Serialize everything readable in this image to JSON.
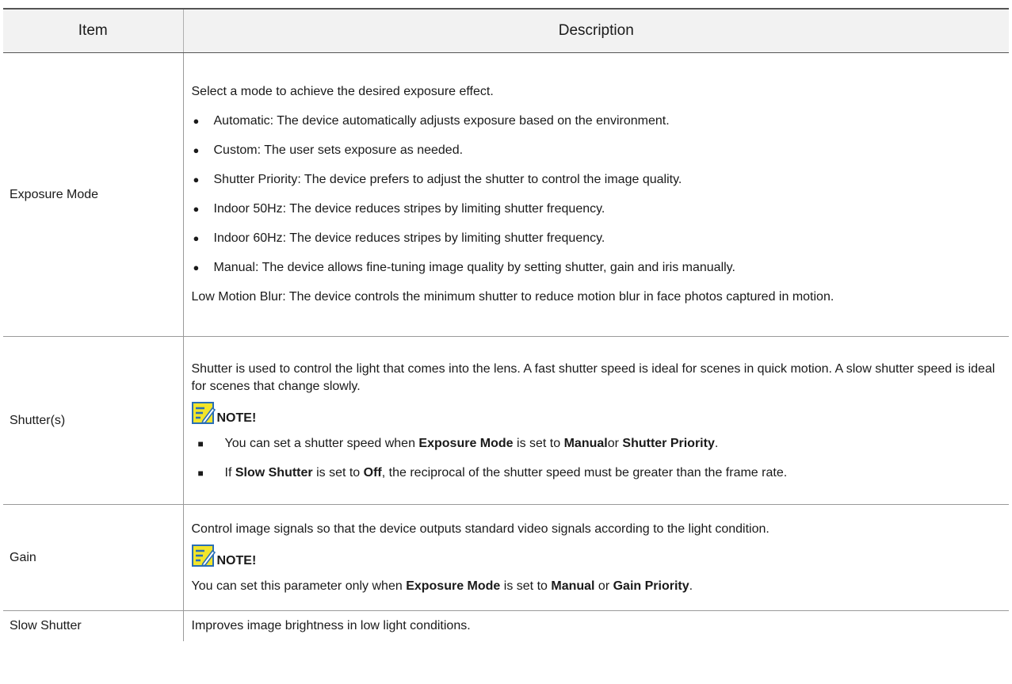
{
  "table": {
    "headers": {
      "item": "Item",
      "description": "Description"
    },
    "rows": {
      "exposure": {
        "item": "Exposure Mode",
        "intro": "Select a mode to achieve the desired exposure effect.",
        "bullets": [
          "Automatic: The device automatically adjusts exposure based on the environment.",
          "Custom: The user sets exposure as needed.",
          "Shutter Priority: The device prefers to adjust the shutter to control the image quality.",
          "Indoor 50Hz: The device reduces stripes by limiting shutter frequency.",
          "Indoor 60Hz: The device reduces stripes by limiting shutter frequency.",
          "Manual: The device allows fine-tuning image quality by setting shutter, gain and iris manually."
        ],
        "outro": "Low Motion Blur: The device controls the minimum shutter to reduce motion blur in face photos captured in motion."
      },
      "shutter": {
        "item": "Shutter(s)",
        "intro": "Shutter is used to control the light that comes into the lens. A fast shutter speed is ideal for scenes in quick motion. A slow shutter speed is ideal for scenes that change slowly.",
        "note_label": "NOTE!",
        "b1": {
          "t1": "You can set a shutter speed when ",
          "k1": "Exposure Mode",
          "t2": " is set to ",
          "k2": "Manual",
          "t3": "or ",
          "k3": "Shutter Priority",
          "t4": "."
        },
        "b2": {
          "t1": "If ",
          "k1": "Slow Shutter",
          "t2": " is set to ",
          "k2": "Off",
          "t3": ", the reciprocal of the shutter speed must be greater than the frame rate."
        }
      },
      "gain": {
        "item": "Gain",
        "intro": "Control image signals so that the device outputs standard video signals according to the light condition.",
        "note_label": "NOTE!",
        "s": {
          "t1": "You can set this parameter only when ",
          "k1": "Exposure Mode",
          "t2": " is set to ",
          "k2": "Manual",
          "t3": " or ",
          "k3": "Gain Priority",
          "t4": "."
        }
      },
      "slow_shutter": {
        "item": "Slow Shutter",
        "desc": "Improves image brightness in low light conditions."
      }
    },
    "bullet_glyph": "●",
    "square_glyph": "■",
    "icon": "note-icon",
    "colors": {
      "note_icon_fill": "#f2e52a",
      "note_icon_stroke": "#2a6fb5"
    }
  }
}
